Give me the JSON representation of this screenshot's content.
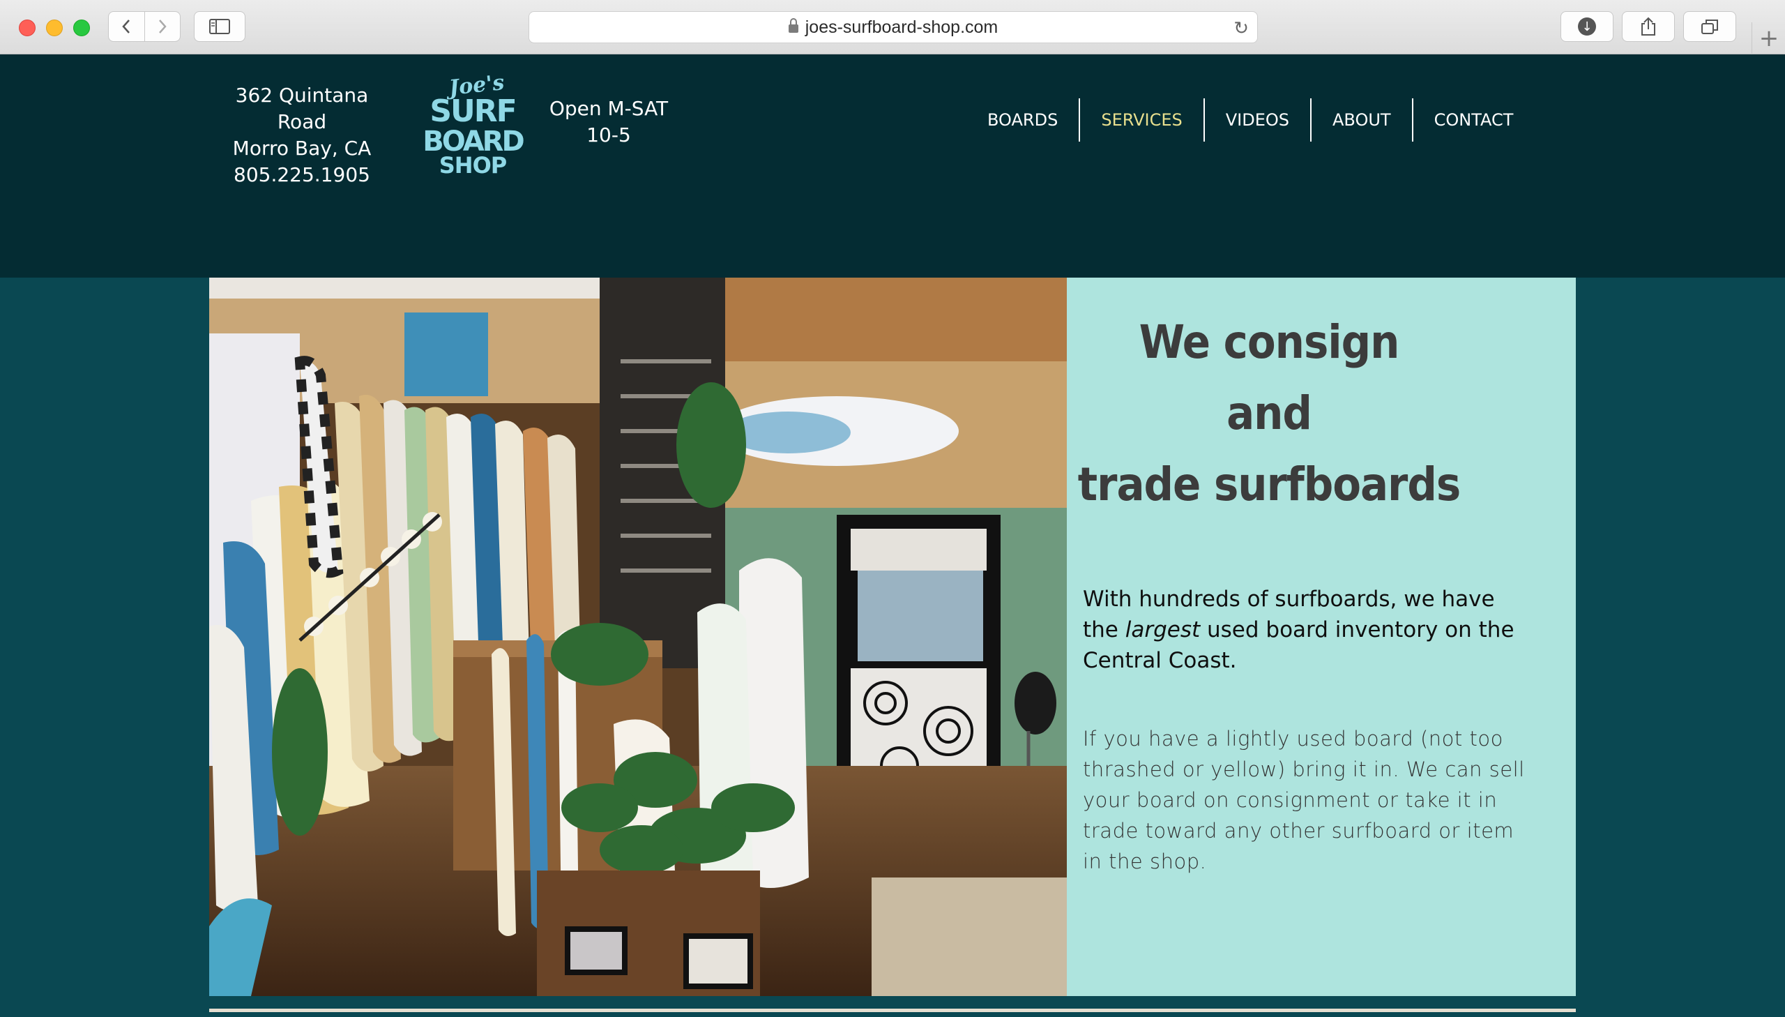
{
  "browser": {
    "url": "joes-surfboard-shop.com"
  },
  "header": {
    "address_line1": "362 Quintana Road",
    "address_line2": "Morro Bay, CA",
    "phone": "805.225.1905",
    "logo_text": [
      "Joe's",
      "SURF",
      "BOARD",
      "SHOP"
    ],
    "hours_line1": "Open M-SAT",
    "hours_line2": "10-5",
    "nav": [
      {
        "label": "BOARDS",
        "active": false
      },
      {
        "label": "SERVICES",
        "active": true
      },
      {
        "label": "VIDEOS",
        "active": false
      },
      {
        "label": "ABOUT",
        "active": false
      },
      {
        "label": "CONTACT",
        "active": false
      }
    ]
  },
  "main": {
    "headline_lines": [
      "We consign",
      "and",
      "trade surfboards"
    ],
    "lead_pre": "With hundreds of surfboards, we have the ",
    "lead_em": "largest",
    "lead_post": " used board inventory on the Central Coast.",
    "body": "If you have a lightly used board (not too thrashed or yellow) bring it in. We can sell your board on consignment or take it in trade toward any other surfboard or item in the shop."
  },
  "colors": {
    "header_bg": "#042c33",
    "page_bg": "#0a4852",
    "panel_bg": "#aee4de",
    "nav_active": "#e8df8e",
    "logo": "#8fd8e6"
  }
}
